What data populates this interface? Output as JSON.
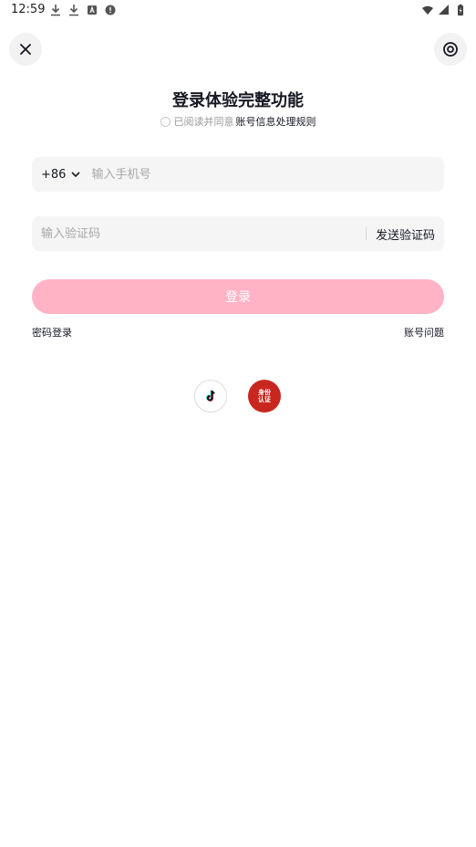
{
  "status_bar": {
    "time": "12:59",
    "left_icons": [
      "download-icon",
      "download-icon",
      "app-icon",
      "alert-icon"
    ],
    "right_icons": [
      "wifi-icon",
      "signal-icon",
      "battery-icon"
    ]
  },
  "header": {
    "close_icon": "close-icon",
    "settings_icon": "target-icon"
  },
  "title": "登录体验完整功能",
  "agreement": {
    "prefix": "已阅读并同意",
    "link": "账号信息处理规则"
  },
  "phone": {
    "country_code": "+86",
    "placeholder": "输入手机号"
  },
  "code": {
    "placeholder": "输入验证码",
    "send_label": "发送验证码"
  },
  "login_label": "登录",
  "links": {
    "password_login": "密码登录",
    "account_issue": "账号问题"
  },
  "third_party": {
    "id_badge_text": "身份认证"
  },
  "colors": {
    "accent_disabled": "#ffb3c5",
    "id_badge": "#c8271f",
    "input_bg": "#f5f5f5"
  }
}
